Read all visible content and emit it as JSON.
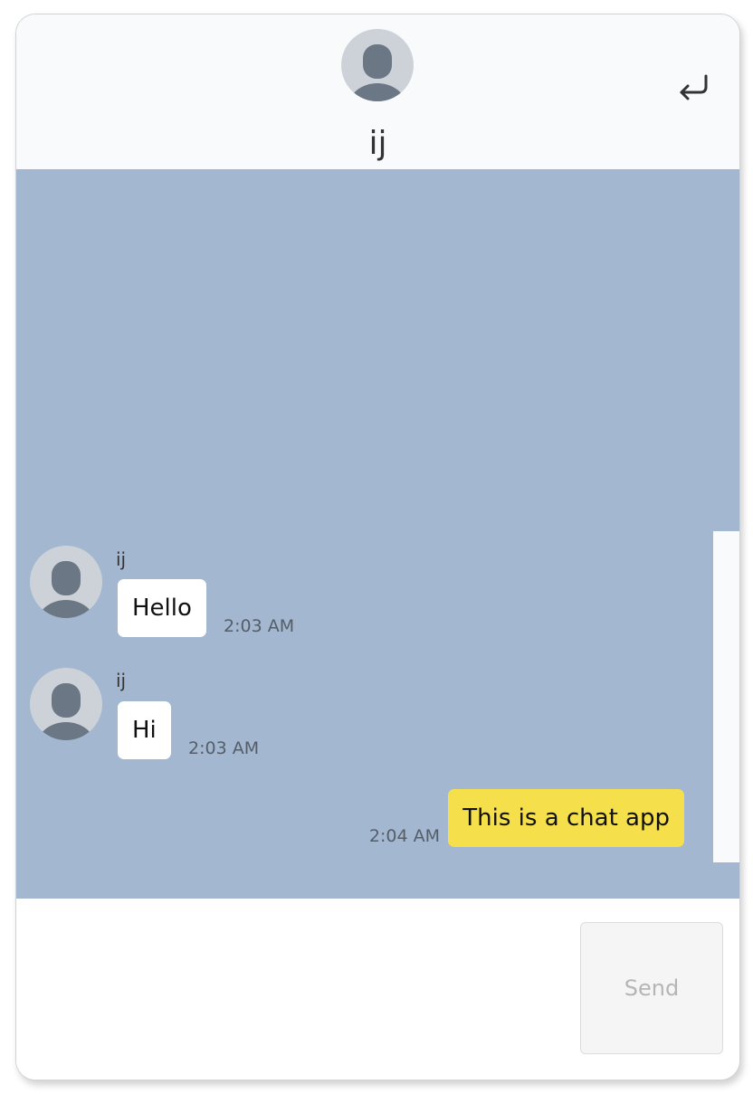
{
  "header": {
    "title": "ij",
    "avatar_icon": "user-avatar-icon",
    "back_icon": "return-arrow-icon"
  },
  "messages": [
    {
      "direction": "incoming",
      "sender": "ij",
      "text": "Hello",
      "time": "2:03 AM"
    },
    {
      "direction": "incoming",
      "sender": "ij",
      "text": "Hi",
      "time": "2:03 AM"
    },
    {
      "direction": "outgoing",
      "text": "This is a chat app",
      "time": "2:04 AM"
    }
  ],
  "composer": {
    "value": "",
    "send_label": "Send"
  },
  "colors": {
    "chat_background": "#a3b8d0",
    "outgoing_bubble": "#f5e04b",
    "incoming_bubble": "#ffffff",
    "header_background": "#f9fafc"
  }
}
